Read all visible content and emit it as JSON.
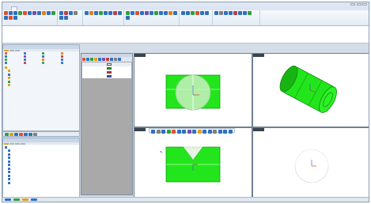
{
  "window": {
    "title": ""
  },
  "ribbon": {
    "tabs": [
      "",
      "",
      "",
      "",
      "",
      "",
      "",
      ""
    ],
    "groups": [
      {
        "label": "",
        "icons": [
          "#e05030",
          "#3070c0",
          "#3070c0",
          "#30a040",
          "#e05030",
          "#3070c0",
          "#7050b0",
          "#3070c0",
          "#e08020",
          "#3070c0",
          "#30a040",
          "#3070c0",
          "#e05030",
          "#3070c0"
        ]
      },
      {
        "label": "",
        "icons": [
          "#3070c0",
          "#c04040",
          "#3070c0",
          "#808080",
          "#3070c0",
          "#3070c0"
        ]
      },
      {
        "label": "",
        "icons": [
          "#3070c0",
          "#e08020",
          "#3070c0",
          "#30a040",
          "#3070c0",
          "#3070c0",
          "#c04040",
          "#3070c0"
        ]
      },
      {
        "label": "",
        "icons": [
          "#30a040",
          "#3070c0",
          "#e05030",
          "#3070c0",
          "#7050b0",
          "#3070c0",
          "#30a040",
          "#3070c0",
          "#3070c0",
          "#e08020",
          "#3070c0",
          "#3070c0"
        ]
      },
      {
        "label": "",
        "icons": [
          "#3070c0",
          "#3070c0",
          "#30a040",
          "#e05030",
          "#3070c0",
          "#3070c0"
        ]
      },
      {
        "label": "",
        "icons": [
          "#3070c0",
          "#808080",
          "#3070c0",
          "#3070c0",
          "#c04040",
          "#3070c0",
          "#3070c0",
          "#30a040"
        ]
      }
    ]
  },
  "command_area": {
    "lines": [
      "",
      "",
      "",
      ""
    ]
  },
  "properties_panel": {
    "title": "",
    "tabs": [
      "",
      "",
      ""
    ],
    "grid": [
      {
        "label": "",
        "color": "#e05030"
      },
      {
        "label": "",
        "color": "#3070c0"
      },
      {
        "label": "",
        "color": "#30a040"
      },
      {
        "label": "",
        "color": "#e08020"
      },
      {
        "label": "",
        "color": "#3070c0"
      },
      {
        "label": "",
        "color": "#7050b0"
      },
      {
        "label": "",
        "color": "#3070c0"
      },
      {
        "label": "",
        "color": "#c04040"
      },
      {
        "label": "",
        "color": "#30a040"
      },
      {
        "label": "",
        "color": "#3070c0"
      },
      {
        "label": "",
        "color": "#e08020"
      },
      {
        "label": "",
        "color": "#3070c0"
      },
      {
        "label": "",
        "color": "#3070c0"
      },
      {
        "label": "",
        "color": "#c04040"
      },
      {
        "label": "",
        "color": "#30a040"
      },
      {
        "label": "",
        "color": "#3070c0"
      }
    ],
    "tree": [
      {
        "label": "",
        "icon": "#e0a020",
        "indent": 0
      },
      {
        "label": "",
        "icon": "#e0a020",
        "indent": 1
      },
      {
        "label": "",
        "icon": "#3070c0",
        "indent": 1
      },
      {
        "label": "",
        "icon": "#e0a020",
        "indent": 1
      },
      {
        "label": "",
        "icon": "#30a040",
        "indent": 1
      },
      {
        "label": "",
        "icon": "#e0a020",
        "indent": 1
      }
    ],
    "tool_buttons": [
      "#30a040",
      "#e0a020",
      "#3070c0",
      "#e05030",
      "#3070c0",
      "#3070c0",
      "#808080"
    ]
  },
  "model_tree_panel": {
    "title": "",
    "tabs": [
      "",
      "",
      "",
      ""
    ],
    "items": [
      {
        "label": "",
        "icon": "#3070c0",
        "indent": 0
      },
      {
        "label": "",
        "icon": "#3070c0",
        "indent": 1
      },
      {
        "label": "",
        "icon": "#3070c0",
        "indent": 1
      },
      {
        "label": "",
        "icon": "#3070c0",
        "indent": 1
      },
      {
        "label": "",
        "icon": "#3070c0",
        "indent": 1
      },
      {
        "label": "",
        "icon": "#3070c0",
        "indent": 1
      },
      {
        "label": "",
        "icon": "#3070c0",
        "indent": 1
      },
      {
        "label": "",
        "icon": "#3070c0",
        "indent": 1
      },
      {
        "label": "",
        "icon": "#3070c0",
        "indent": 1
      },
      {
        "label": "",
        "icon": "#3070c0",
        "indent": 1
      },
      {
        "label": "",
        "icon": "#3070c0",
        "indent": 1
      }
    ]
  },
  "swatch_panel": {
    "title": "",
    "toolbar": [
      "#e05030",
      "#3070c0",
      "#30a040",
      "#e0a020",
      "#3070c0",
      "#7050b0",
      "#c04040",
      "#3070c0",
      "#808080",
      "#3070c0"
    ],
    "rows": [
      {
        "name": "",
        "value": "",
        "chip": "#ffffff",
        "header": true
      },
      {
        "name": "",
        "value": "",
        "chip": "#22aa22",
        "header": false
      },
      {
        "name": "",
        "value": "",
        "chip": "#e02020",
        "header": false
      },
      {
        "name": "",
        "value": "",
        "chip": "#2040d0",
        "header": false
      }
    ]
  },
  "viewport_toolbar": [
    "#3070c0",
    "#808080",
    "#3070c0",
    "#30a040",
    "#e05030",
    "#3070c0",
    "#3070c0",
    "#7050b0",
    "#3070c0",
    "#e0a020",
    "#3070c0",
    "#3070c0",
    "#808080",
    "#3070c0",
    "#3070c0",
    "#3070c0"
  ],
  "colors": {
    "model_green": "#22e61b",
    "model_dark": "#13a510",
    "viewport_bg": "#ffffff",
    "accent": "#3070c0"
  },
  "status_bar": [
    "#3070c0",
    "#30a040",
    "#e0a020",
    "#3070c0"
  ]
}
